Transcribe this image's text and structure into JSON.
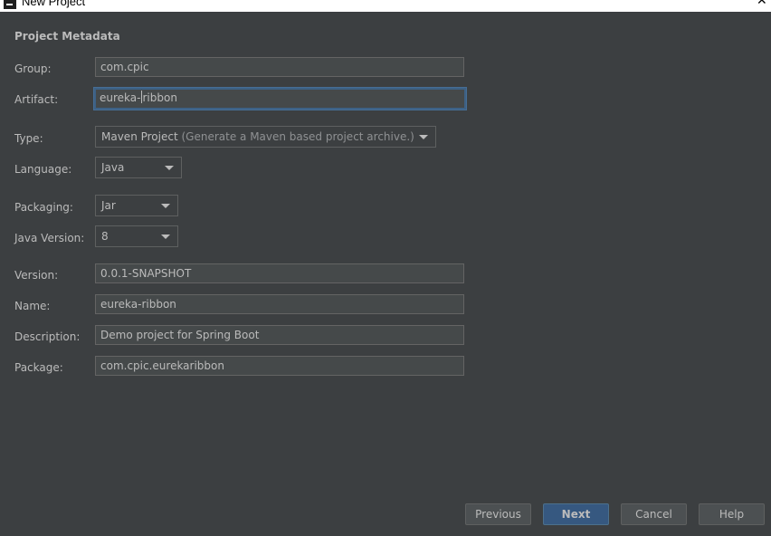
{
  "window": {
    "title": "New Project"
  },
  "section": {
    "title": "Project Metadata"
  },
  "form": {
    "group": {
      "label": "Group:",
      "value": "com.cpic"
    },
    "artifact": {
      "label": "Artifact:",
      "value_before_caret": "eureka-",
      "value_after_caret": "ribbon"
    },
    "type": {
      "label": "Type:",
      "value": "Maven Project",
      "hint": " (Generate a Maven based project archive.)"
    },
    "language": {
      "label": "Language:",
      "value": "Java"
    },
    "packaging": {
      "label": "Packaging:",
      "value": "Jar"
    },
    "java_version": {
      "label": "Java Version:",
      "value": "8"
    },
    "version": {
      "label": "Version:",
      "value": "0.0.1-SNAPSHOT"
    },
    "name": {
      "label": "Name:",
      "value": "eureka-ribbon"
    },
    "description": {
      "label": "Description:",
      "value": "Demo project for Spring Boot"
    },
    "package": {
      "label": "Package:",
      "value": "com.cpic.eurekaribbon"
    }
  },
  "buttons": {
    "previous": "Previous",
    "next": "Next",
    "cancel": "Cancel",
    "help": "Help"
  },
  "colors": {
    "background": "#3c3f41",
    "field_bg": "#45494a",
    "focus_border": "#3d6185",
    "primary_button": "#365880",
    "text": "#bbbbbb"
  }
}
